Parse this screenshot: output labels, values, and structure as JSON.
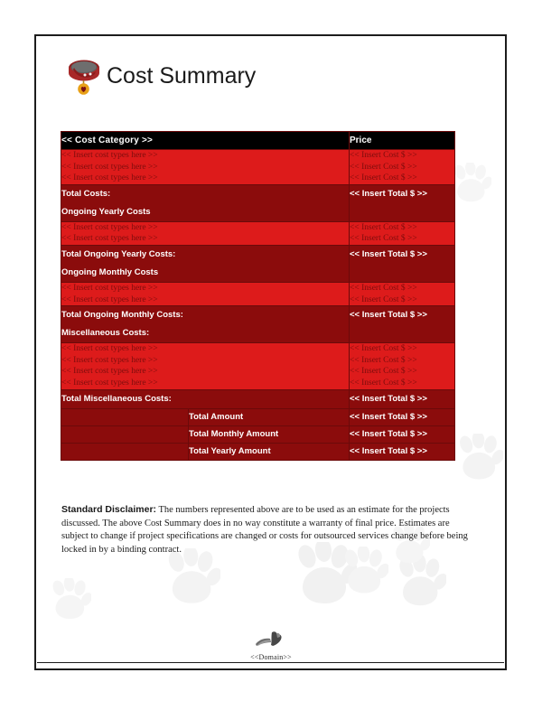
{
  "document": {
    "title": "Cost Summary",
    "logo_icon": "dog-collar-heart-tag-icon"
  },
  "table": {
    "headers": {
      "category": "<< Cost Category >>",
      "price": "Price"
    },
    "placeholder_cost": "<< Insert cost types here >>",
    "placeholder_price": "<< Insert Cost $ >>",
    "placeholder_total": "<< Insert Total $ >>",
    "sections": [
      {
        "kind": "insert",
        "rows": [
          {
            "label": "<< Insert cost types here >>",
            "price": "<< Insert Cost $ >>"
          },
          {
            "label": "<< Insert cost types here >>",
            "price": "<< Insert Cost $ >>"
          },
          {
            "label": "<< Insert cost types here >>",
            "price": "<< Insert Cost $ >>"
          }
        ]
      },
      {
        "kind": "total",
        "lines": [
          {
            "label": "Total Costs:",
            "price": "<< Insert Total $ >>"
          },
          {
            "label": "Ongoing Yearly Costs",
            "price": ""
          }
        ]
      },
      {
        "kind": "insert",
        "rows": [
          {
            "label": "<< Insert cost types here >>",
            "price": "<< Insert Cost $ >>"
          },
          {
            "label": "<< Insert cost types here >>",
            "price": "<< Insert Cost $ >>"
          }
        ]
      },
      {
        "kind": "total",
        "lines": [
          {
            "label": "Total Ongoing Yearly Costs:",
            "price": "<< Insert Total $ >>"
          },
          {
            "label": "Ongoing Monthly Costs",
            "price": ""
          }
        ]
      },
      {
        "kind": "insert",
        "rows": [
          {
            "label": "<< Insert cost types here >>",
            "price": "<< Insert Cost $ >>"
          },
          {
            "label": "<< Insert cost types here >>",
            "price": "<< Insert Cost $ >>"
          }
        ]
      },
      {
        "kind": "total",
        "lines": [
          {
            "label": "Total Ongoing Monthly Costs:",
            "price": "<< Insert Total $ >>"
          },
          {
            "label": "Miscellaneous Costs:",
            "price": ""
          }
        ]
      },
      {
        "kind": "insert",
        "rows": [
          {
            "label": "<< Insert cost types here >>",
            "price": "<< Insert Cost $ >>"
          },
          {
            "label": "<< Insert cost types here >>",
            "price": "<< Insert Cost $ >>"
          },
          {
            "label": "<< Insert cost types here >>",
            "price": "<< Insert Cost $ >>"
          },
          {
            "label": "<< Insert cost types here >>",
            "price": "<< Insert Cost $ >>"
          }
        ]
      },
      {
        "kind": "total",
        "lines": [
          {
            "label": "Total Miscellaneous Costs:",
            "price": "<< Insert Total $ >>"
          }
        ]
      }
    ],
    "summary_rows": [
      {
        "blank": "",
        "label": "Total Amount",
        "price": "<< Insert Total $ >>"
      },
      {
        "blank": "",
        "label": "Total Monthly Amount",
        "price": "<< Insert Total $ >>"
      },
      {
        "blank": "",
        "label": "Total Yearly Amount",
        "price": "<< Insert Total $ >>"
      }
    ]
  },
  "disclaimer": {
    "lead": "Standard Disclaimer:",
    "body": " The numbers represented above are to be used as an estimate for the projects discussed. The above Cost Summary does in no way constitute a warranty of final price.  Estimates are subject to change if project specifications are changed or costs for outsourced services change before being locked in by a binding contract."
  },
  "footer": {
    "domain": "<<Domain>>",
    "mark_icon": "dog-bone-paw-icon"
  },
  "colors": {
    "header_black": "#000000",
    "row_light_red": "#dd1b1b",
    "row_dark_red": "#8b0c0c",
    "insert_text_red": "#7d0d0d",
    "border_red": "#6b0a0a",
    "page_border": "#1c1c1c",
    "collar_red": "#a52424",
    "heart_gold": "#e8a017",
    "watermark_gray": "#f0f0f0"
  }
}
